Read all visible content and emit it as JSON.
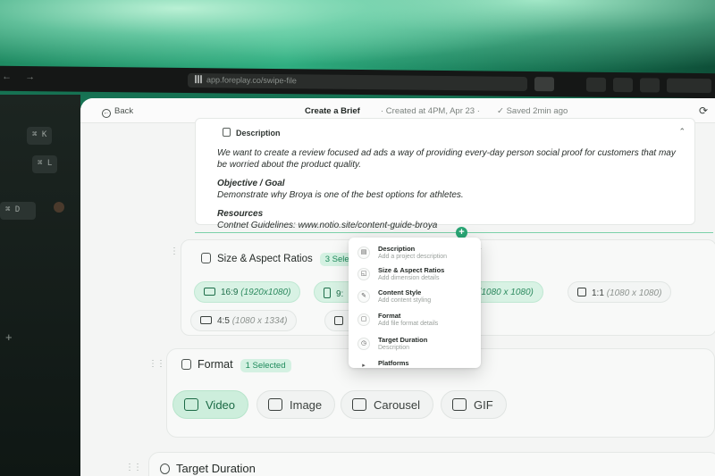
{
  "browser": {
    "url": "app.foreplay.co/swipe-file",
    "nav": "← →"
  },
  "sidebar": {
    "shortcuts": [
      "⌘ K",
      "⌘ L",
      "⌘ D"
    ],
    "plus": "+"
  },
  "topbar": {
    "back_label": "Back",
    "title": "Create a Brief",
    "created": "·  Created at 4PM, Apr 23  ·",
    "saved": "✓  Saved 2min ago"
  },
  "description": {
    "heading": "Description",
    "body": "We want to create a review focused ad ads a way of providing every-day person social proof for customers that may be worried about the product quality.",
    "objective_heading": "Objective / Goal",
    "objective_text": "Demonstrate why Broya is one of the best options for athletes.",
    "resources_heading": "Resources",
    "resources_text": "Contnet Guidelines: www.notio.site/content-guide-broya"
  },
  "size": {
    "title": "Size & Aspect Ratios",
    "badge": "3 Selected",
    "chips": [
      {
        "ratio": "16:9",
        "dims": "(1920x1080)",
        "selected": true
      },
      {
        "ratio": "9:",
        "dims": "",
        "selected": true
      },
      {
        "ratio": ":1",
        "dims": "(1080 x 1080)",
        "selected": true
      },
      {
        "ratio": "1:1",
        "dims": "(1080 x 1080)",
        "selected": false
      },
      {
        "ratio": "4:5",
        "dims": "(1080 x 1334)",
        "selected": false
      },
      {
        "ratio": "2",
        "dims": "",
        "selected": false
      }
    ]
  },
  "format": {
    "title": "Format",
    "badge": "1 Selected",
    "options": [
      {
        "label": "Video",
        "icon": "film-icon",
        "selected": true
      },
      {
        "label": "Image",
        "icon": "image-icon",
        "selected": false
      },
      {
        "label": "Carousel",
        "icon": "carousel-icon",
        "selected": false
      },
      {
        "label": "GIF",
        "icon": "gif-icon",
        "selected": false
      }
    ]
  },
  "target_duration": {
    "title": "Target Duration"
  },
  "popup": {
    "add_symbol": "+",
    "items": [
      {
        "title": "Description",
        "sub": "Add a project description",
        "icon": "doc-icon"
      },
      {
        "title": "Size & Aspect Ratios",
        "sub": "Add dimension details",
        "icon": "aspect-icon"
      },
      {
        "title": "Content Style",
        "sub": "Add content styling",
        "icon": "brush-icon"
      },
      {
        "title": "Format",
        "sub": "Add file format details",
        "icon": "file-icon"
      },
      {
        "title": "Target Duration",
        "sub": "Description",
        "icon": "clock-icon"
      },
      {
        "title": "Platforms",
        "sub": "",
        "icon": "play-icon"
      }
    ]
  },
  "colors": {
    "accent": "#29a574",
    "selected_bg": "#d8f2e4"
  }
}
